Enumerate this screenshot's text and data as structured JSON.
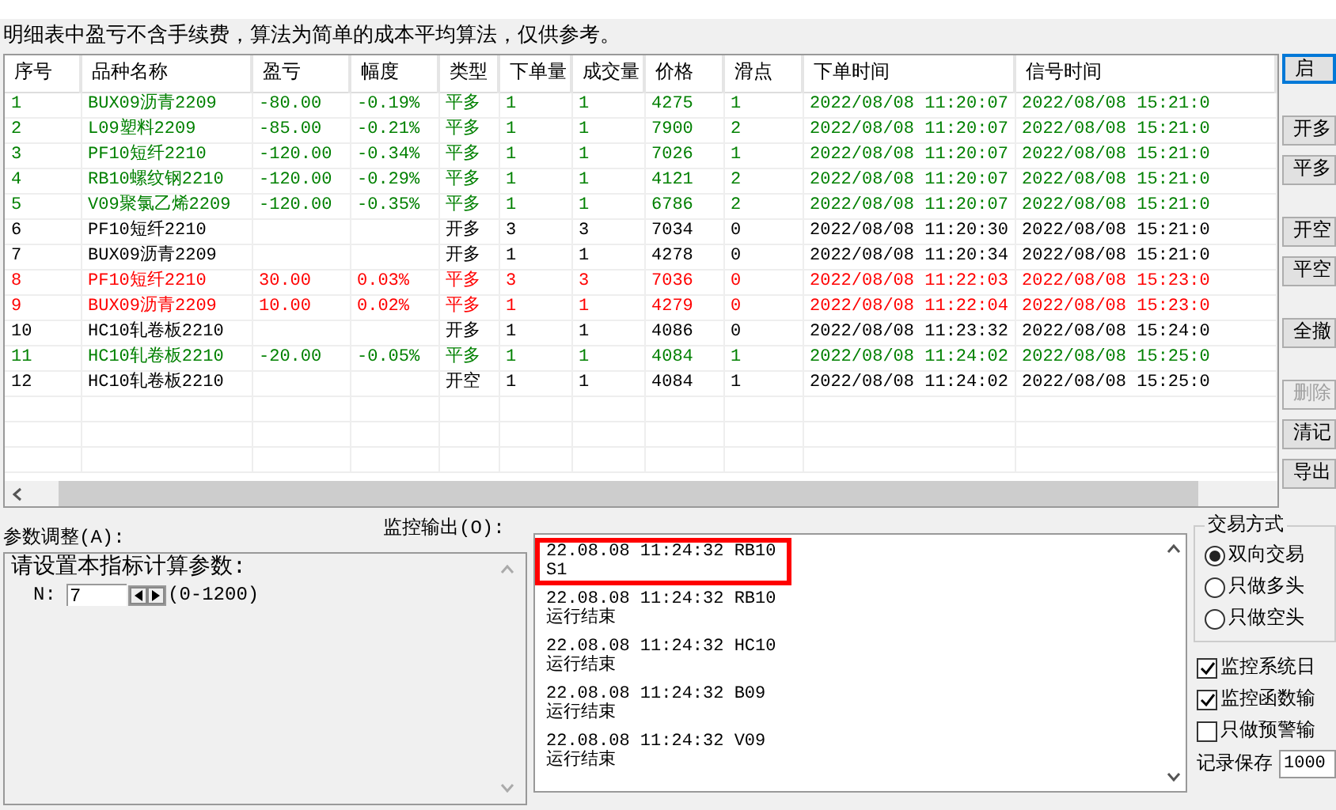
{
  "notice": "明细表中盈亏不含手续费，算法为简单的成本平均算法，仅供参考。",
  "table": {
    "columns": [
      "序号",
      "品种名称",
      "盈亏",
      "幅度",
      "类型",
      "下单量",
      "成交量",
      "价格",
      "滑点",
      "下单时间",
      "信号时间"
    ],
    "rows": [
      {
        "color": "#008000",
        "cells": [
          "1",
          "BUX09沥青2209",
          "-80.00",
          "-0.19%",
          "平多",
          "1",
          "1",
          "4275",
          "1",
          "2022/08/08 11:20:07",
          "2022/08/08 15:21:0"
        ]
      },
      {
        "color": "#008000",
        "cells": [
          "2",
          "L09塑料2209",
          "-85.00",
          "-0.21%",
          "平多",
          "1",
          "1",
          "7900",
          "2",
          "2022/08/08 11:20:07",
          "2022/08/08 15:21:0"
        ]
      },
      {
        "color": "#008000",
        "cells": [
          "3",
          "PF10短纤2210",
          "-120.00",
          "-0.34%",
          "平多",
          "1",
          "1",
          "7026",
          "1",
          "2022/08/08 11:20:07",
          "2022/08/08 15:21:0"
        ]
      },
      {
        "color": "#008000",
        "cells": [
          "4",
          "RB10螺纹钢2210",
          "-120.00",
          "-0.29%",
          "平多",
          "1",
          "1",
          "4121",
          "2",
          "2022/08/08 11:20:07",
          "2022/08/08 15:21:0"
        ]
      },
      {
        "color": "#008000",
        "cells": [
          "5",
          "V09聚氯乙烯2209",
          "-120.00",
          "-0.35%",
          "平多",
          "1",
          "1",
          "6786",
          "2",
          "2022/08/08 11:20:07",
          "2022/08/08 15:21:0"
        ]
      },
      {
        "color": "#000000",
        "cells": [
          "6",
          "PF10短纤2210",
          "",
          "",
          "开多",
          "3",
          "3",
          "7034",
          "0",
          "2022/08/08 11:20:30",
          "2022/08/08 15:21:0"
        ]
      },
      {
        "color": "#000000",
        "cells": [
          "7",
          "BUX09沥青2209",
          "",
          "",
          "开多",
          "1",
          "1",
          "4278",
          "0",
          "2022/08/08 11:20:34",
          "2022/08/08 15:21:0"
        ]
      },
      {
        "color": "#ff0000",
        "cells": [
          "8",
          "PF10短纤2210",
          "30.00",
          "0.03%",
          "平多",
          "3",
          "3",
          "7036",
          "0",
          "2022/08/08 11:22:03",
          "2022/08/08 15:23:0"
        ]
      },
      {
        "color": "#ff0000",
        "cells": [
          "9",
          "BUX09沥青2209",
          "10.00",
          "0.02%",
          "平多",
          "1",
          "1",
          "4279",
          "0",
          "2022/08/08 11:22:04",
          "2022/08/08 15:23:0"
        ]
      },
      {
        "color": "#000000",
        "cells": [
          "10",
          "HC10轧卷板2210",
          "",
          "",
          "开多",
          "1",
          "1",
          "4086",
          "0",
          "2022/08/08 11:23:32",
          "2022/08/08 15:24:0"
        ]
      },
      {
        "color": "#008000",
        "cells": [
          "11",
          "HC10轧卷板2210",
          "-20.00",
          "-0.05%",
          "平多",
          "1",
          "1",
          "4084",
          "1",
          "2022/08/08 11:24:02",
          "2022/08/08 15:25:0"
        ]
      },
      {
        "color": "#000000",
        "cells": [
          "12",
          "HC10轧卷板2210",
          "",
          "",
          "开空",
          "1",
          "1",
          "4084",
          "1",
          "2022/08/08 11:24:02",
          "2022/08/08 15:25:0"
        ]
      }
    ]
  },
  "side_buttons": [
    {
      "label": "启",
      "disabled": false
    },
    {
      "label": "开多",
      "disabled": false
    },
    {
      "label": "平多",
      "disabled": false
    },
    {
      "label": "开空",
      "disabled": false
    },
    {
      "label": "平空",
      "disabled": false
    },
    {
      "label": "全撤",
      "disabled": false
    },
    {
      "label": "删除",
      "disabled": true
    },
    {
      "label": "清记",
      "disabled": false
    },
    {
      "label": "导出",
      "disabled": false
    }
  ],
  "params": {
    "label": "参数调整(A):",
    "prompt": "请设置本指标计算参数:",
    "name": "N:",
    "value": "7",
    "range": "(0-1200)"
  },
  "monitor": {
    "label": "监控输出(O):",
    "entries": [
      {
        "lines": [
          "22.08.08 11:24:32 RB10",
          "S1"
        ],
        "highlighted": true
      },
      {
        "lines": [
          "22.08.08 11:24:32 RB10",
          "运行结束"
        ],
        "highlighted": false
      },
      {
        "lines": [
          "22.08.08 11:24:32 HC10",
          "运行结束"
        ],
        "highlighted": false
      },
      {
        "lines": [
          "22.08.08 11:24:32 B09",
          "运行结束"
        ],
        "highlighted": false
      },
      {
        "lines": [
          "22.08.08 11:24:32 V09",
          "运行结束"
        ],
        "highlighted": false
      }
    ]
  },
  "trade_mode": {
    "title": "交易方式",
    "options": [
      {
        "label": "双向交易",
        "selected": true
      },
      {
        "label": "只做多头",
        "selected": false
      },
      {
        "label": "只做空头",
        "selected": false
      }
    ]
  },
  "checkboxes": [
    {
      "label": "监控系统日",
      "checked": true
    },
    {
      "label": "监控函数输",
      "checked": true
    },
    {
      "label": "只做预警输",
      "checked": false
    }
  ],
  "record": {
    "label": "记录保存",
    "value": "1000"
  }
}
